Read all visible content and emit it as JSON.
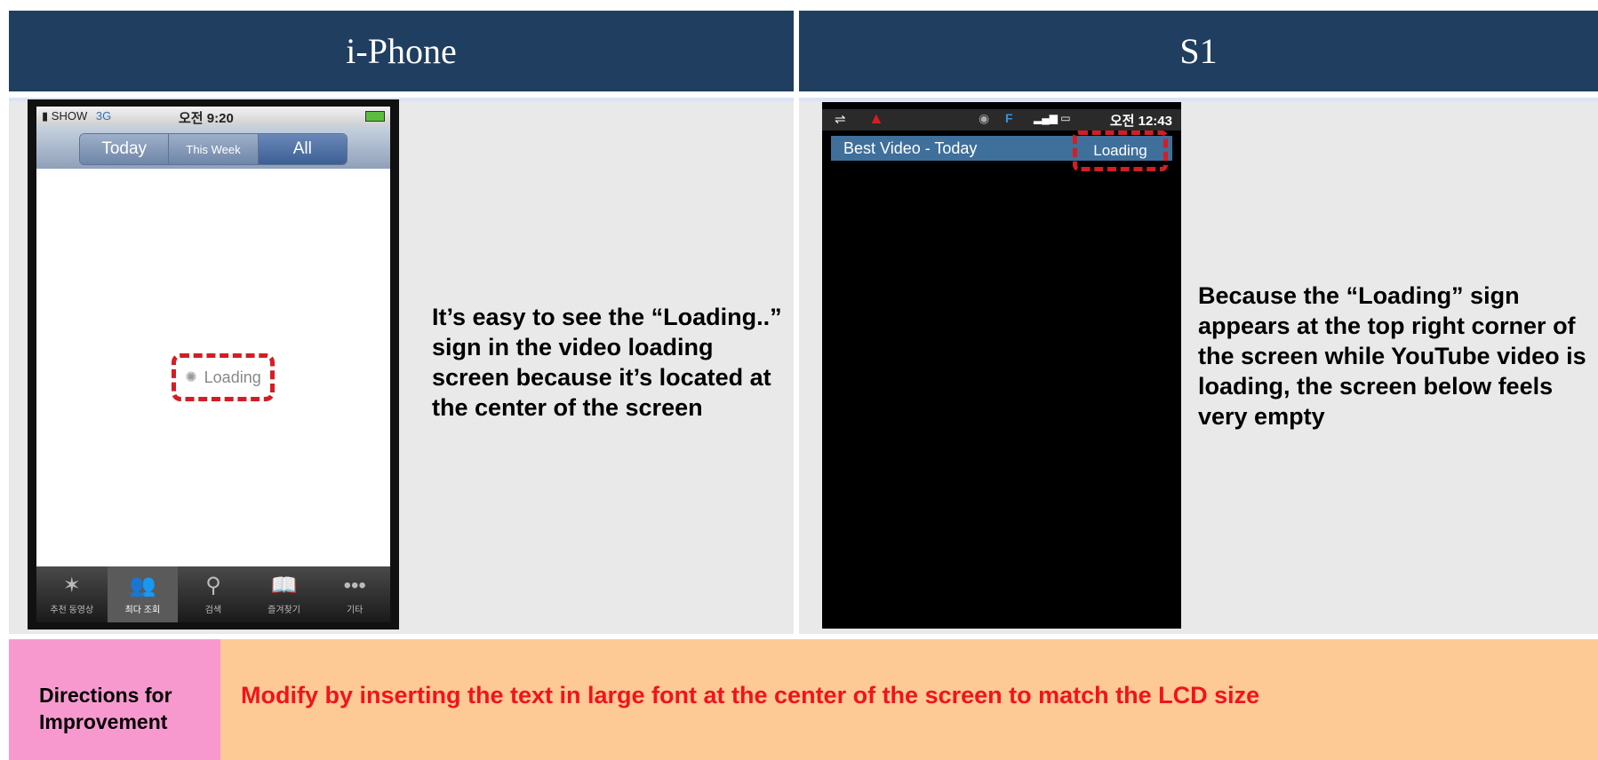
{
  "headers": {
    "left": "i-Phone",
    "right": "S1"
  },
  "iphone": {
    "status": {
      "carrier": "SHOW",
      "network": "3G",
      "time": "오전 9:20"
    },
    "segments": [
      "Today",
      "This Week",
      "All"
    ],
    "active_segment": "All",
    "loading_text": "Loading",
    "tabs": [
      {
        "icon": "featured-icon",
        "label": "추천 동영상"
      },
      {
        "icon": "most-viewed-icon",
        "label": "최다 조회"
      },
      {
        "icon": "search-icon",
        "label": "검색"
      },
      {
        "icon": "bookmarks-icon",
        "label": "즐겨찾기"
      },
      {
        "icon": "more-icon",
        "label": "기타"
      }
    ],
    "active_tab": "최다 조회"
  },
  "s1": {
    "status": {
      "time": "오전 12:43"
    },
    "title": "Best Video - Today",
    "loading_text": "Loading"
  },
  "descriptions": {
    "left": "It’s easy to see the “Loading..” sign in the video loading screen because it’s located at the center of the screen",
    "right": "Because the “Loading” sign appears at the top right corner of the screen while YouTube video is loading, the screen below feels very empty"
  },
  "bottom": {
    "label": "Directions for Improvement",
    "message": "Modify by inserting the text in large font at the center of the screen to match the LCD size"
  },
  "colors": {
    "header_bg": "#1f3e60",
    "highlight_dash": "#d21e24",
    "label_bg": "#f799cf",
    "message_bg": "#fdca95",
    "message_text": "#f2131c"
  }
}
